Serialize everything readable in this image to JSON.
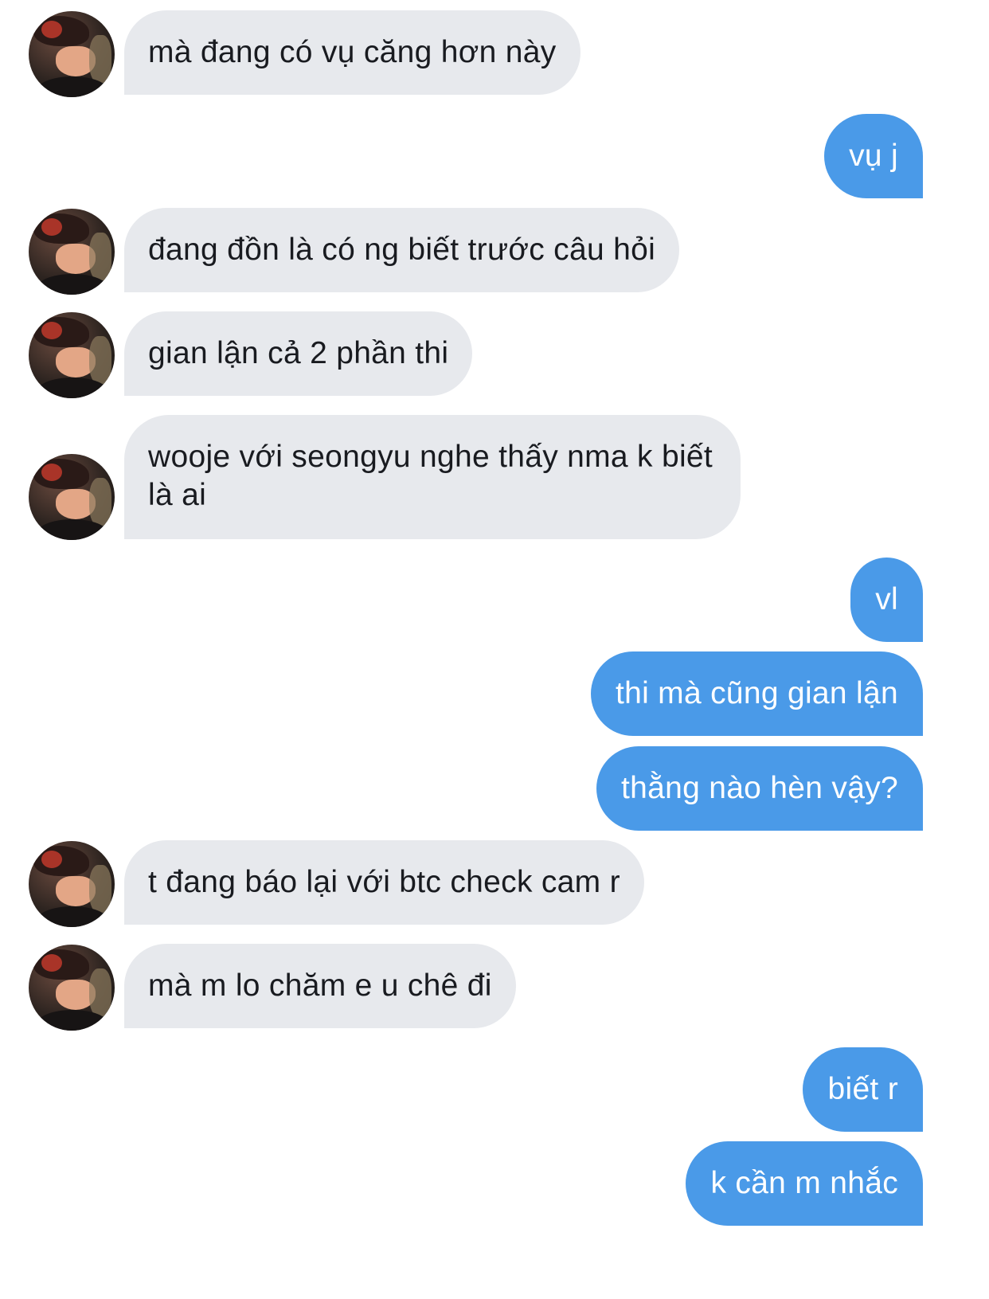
{
  "conversation": {
    "messages": [
      {
        "sender": "other",
        "text": "mà đang có vụ căng hơn này"
      },
      {
        "sender": "me",
        "text": "vụ j"
      },
      {
        "sender": "other",
        "text": "đang đồn là có ng biết trước câu hỏi"
      },
      {
        "sender": "other",
        "text": "gian lận cả 2 phần thi"
      },
      {
        "sender": "other",
        "text": "wooje với seongyu nghe thấy nma k biết là ai"
      },
      {
        "sender": "me",
        "text": "vl"
      },
      {
        "sender": "me",
        "text": "thi mà cũng gian lận"
      },
      {
        "sender": "me",
        "text": "thằng nào hèn vậy?"
      },
      {
        "sender": "other",
        "text": "t đang báo lại với btc check cam r"
      },
      {
        "sender": "other",
        "text": "mà m lo chăm e u chê đi"
      },
      {
        "sender": "me",
        "text": "biết r"
      },
      {
        "sender": "me",
        "text": "k cần m nhắc"
      }
    ]
  },
  "colors": {
    "incoming_bubble": "#e7e9ed",
    "outgoing_bubble": "#4a9ae8",
    "incoming_text": "#191b20",
    "outgoing_text": "#ffffff",
    "background": "#ffffff"
  },
  "icons": {
    "contact_avatar": "avatar"
  }
}
